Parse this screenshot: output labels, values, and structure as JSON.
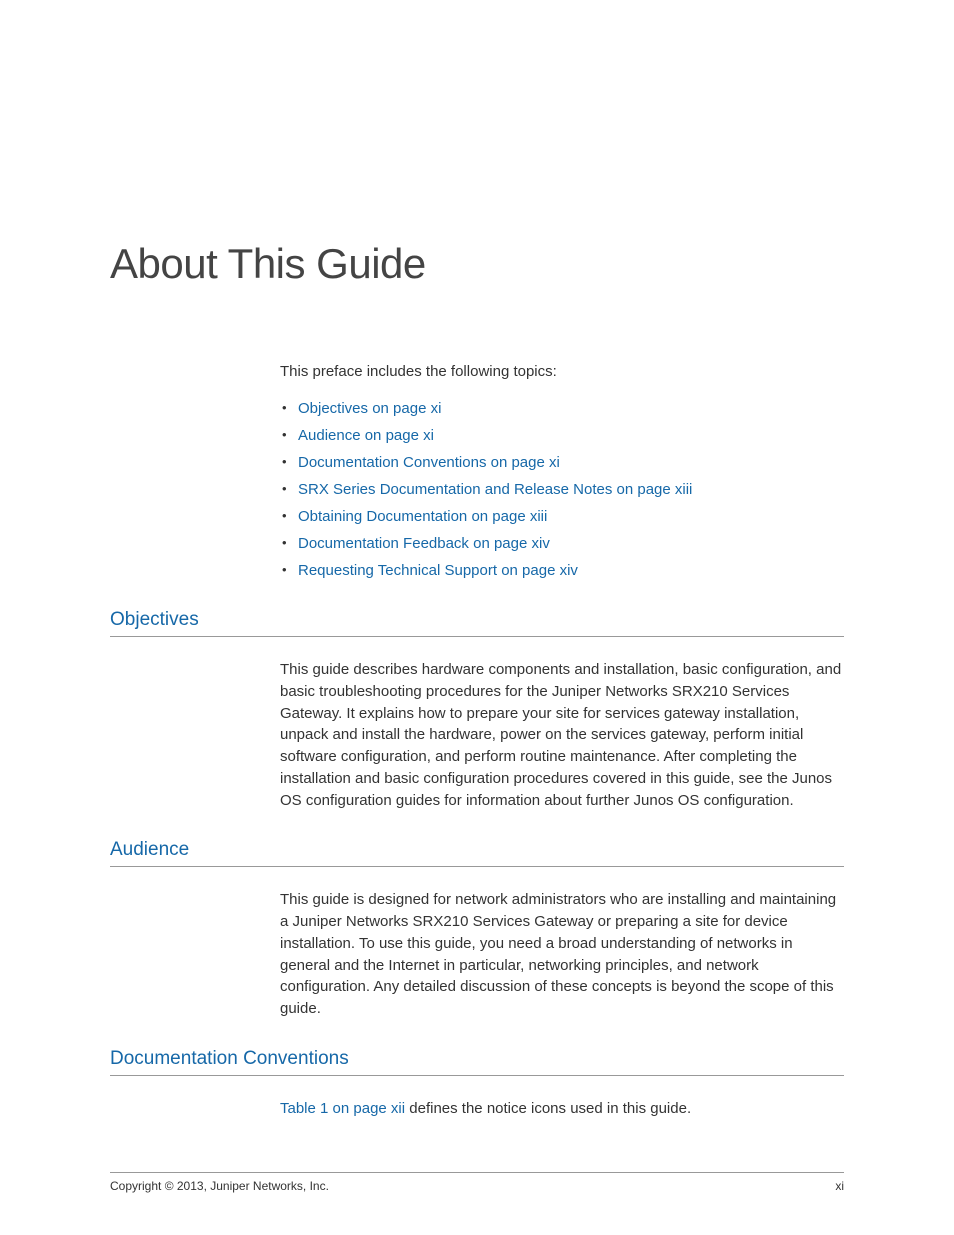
{
  "title": "About This Guide",
  "intro": "This preface includes the following topics:",
  "topics": [
    "Objectives on page xi",
    "Audience on page xi",
    "Documentation Conventions on page xi",
    "SRX Series Documentation and Release Notes on page xiii",
    "Obtaining Documentation on page xiii",
    "Documentation Feedback on page xiv",
    "Requesting Technical Support on page xiv"
  ],
  "sections": {
    "objectives": {
      "heading": "Objectives",
      "body": "This guide describes hardware components and installation, basic configuration, and basic troubleshooting procedures for the Juniper Networks SRX210 Services Gateway. It explains how to prepare your site for services gateway installation, unpack and install the hardware, power on the services gateway, perform initial software configuration, and perform routine maintenance. After completing the installation and basic configuration procedures covered in this guide, see the Junos OS configuration guides for information about further Junos OS configuration."
    },
    "audience": {
      "heading": "Audience",
      "body": "This guide is designed for network administrators who are installing and maintaining a Juniper Networks SRX210 Services Gateway or preparing a site for device installation. To use this guide, you need a broad understanding of networks in general and the Internet in particular, networking principles, and network configuration. Any detailed discussion of these concepts is beyond the scope of this guide."
    },
    "conventions": {
      "heading": "Documentation Conventions",
      "body_link": "Table 1 on page xii",
      "body_rest": " defines the notice icons used in this guide."
    }
  },
  "footer": {
    "copyright": "Copyright © 2013, Juniper Networks, Inc.",
    "page": "xi"
  }
}
